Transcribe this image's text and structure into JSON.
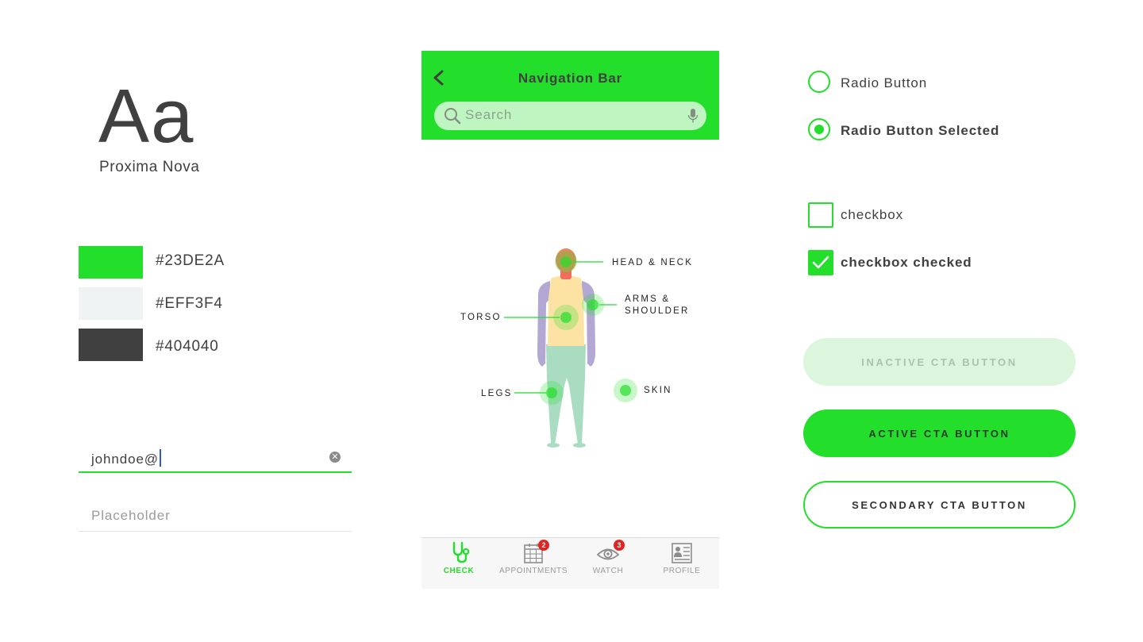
{
  "typography": {
    "sample": "Aa",
    "font_name": "Proxima Nova"
  },
  "colors": [
    {
      "hex": "#23DE2A",
      "label": "#23DE2A"
    },
    {
      "hex": "#EFF3F4",
      "label": "#EFF3F4"
    },
    {
      "hex": "#404040",
      "label": "#404040"
    }
  ],
  "fields": {
    "email_value": "johndoe@",
    "placeholder": "Placeholder"
  },
  "phone": {
    "nav_title": "Navigation Bar",
    "search_placeholder": "Search",
    "body_map": {
      "regions": {
        "head_neck": "HEAD & NECK",
        "arms_line1": "ARMS &",
        "arms_line2": "SHOULDER",
        "torso": "TORSO",
        "legs": "LEGS",
        "skin": "SKIN"
      }
    },
    "tabs": [
      {
        "label": "CHECK",
        "icon": "stethoscope-icon",
        "active": true
      },
      {
        "label": "APPOINTMENTS",
        "icon": "calendar-icon",
        "badge": "2"
      },
      {
        "label": "WATCH",
        "icon": "eye-icon",
        "badge": "3"
      },
      {
        "label": "PROFILE",
        "icon": "profile-card-icon"
      }
    ]
  },
  "controls": {
    "radio_label": "Radio Button",
    "radio_selected_label": "Radio Button Selected",
    "checkbox_label": "checkbox",
    "checkbox_checked_label": "checkbox checked",
    "inactive_cta": "INACTIVE CTA BUTTON",
    "active_cta": "ACTIVE CTA BUTTON",
    "secondary_cta": "SECONDARY CTA BUTTON"
  },
  "theme": {
    "accent": "#23DE2A",
    "text": "#404040",
    "light": "#EFF3F4",
    "badge": "#E02424"
  }
}
